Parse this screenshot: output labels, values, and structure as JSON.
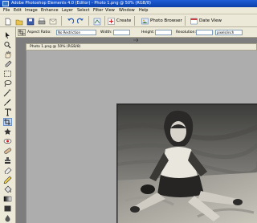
{
  "window": {
    "title": "Adobe Photoshop Elements 4.0 (Editor) - Photo 1.png @ 50% (RGB/8)"
  },
  "menu": [
    "File",
    "Edit",
    "Image",
    "Enhance",
    "Layer",
    "Select",
    "Filter",
    "View",
    "Window",
    "Help"
  ],
  "shortcuts": {
    "create_label": "Create",
    "photo_browser_label": "Photo Browser",
    "date_view_label": "Date View"
  },
  "options": {
    "aspect_ratio_label": "Aspect Ratio:",
    "aspect_ratio_value": "No Restriction",
    "width_label": "Width:",
    "width_value": "",
    "height_label": "Height:",
    "height_value": "",
    "resolution_label": "Resolution:",
    "resolution_value": "",
    "resolution_unit": "pixels/inch"
  },
  "document": {
    "title": "Photo 1.png @ 50% (RGB/8)"
  }
}
